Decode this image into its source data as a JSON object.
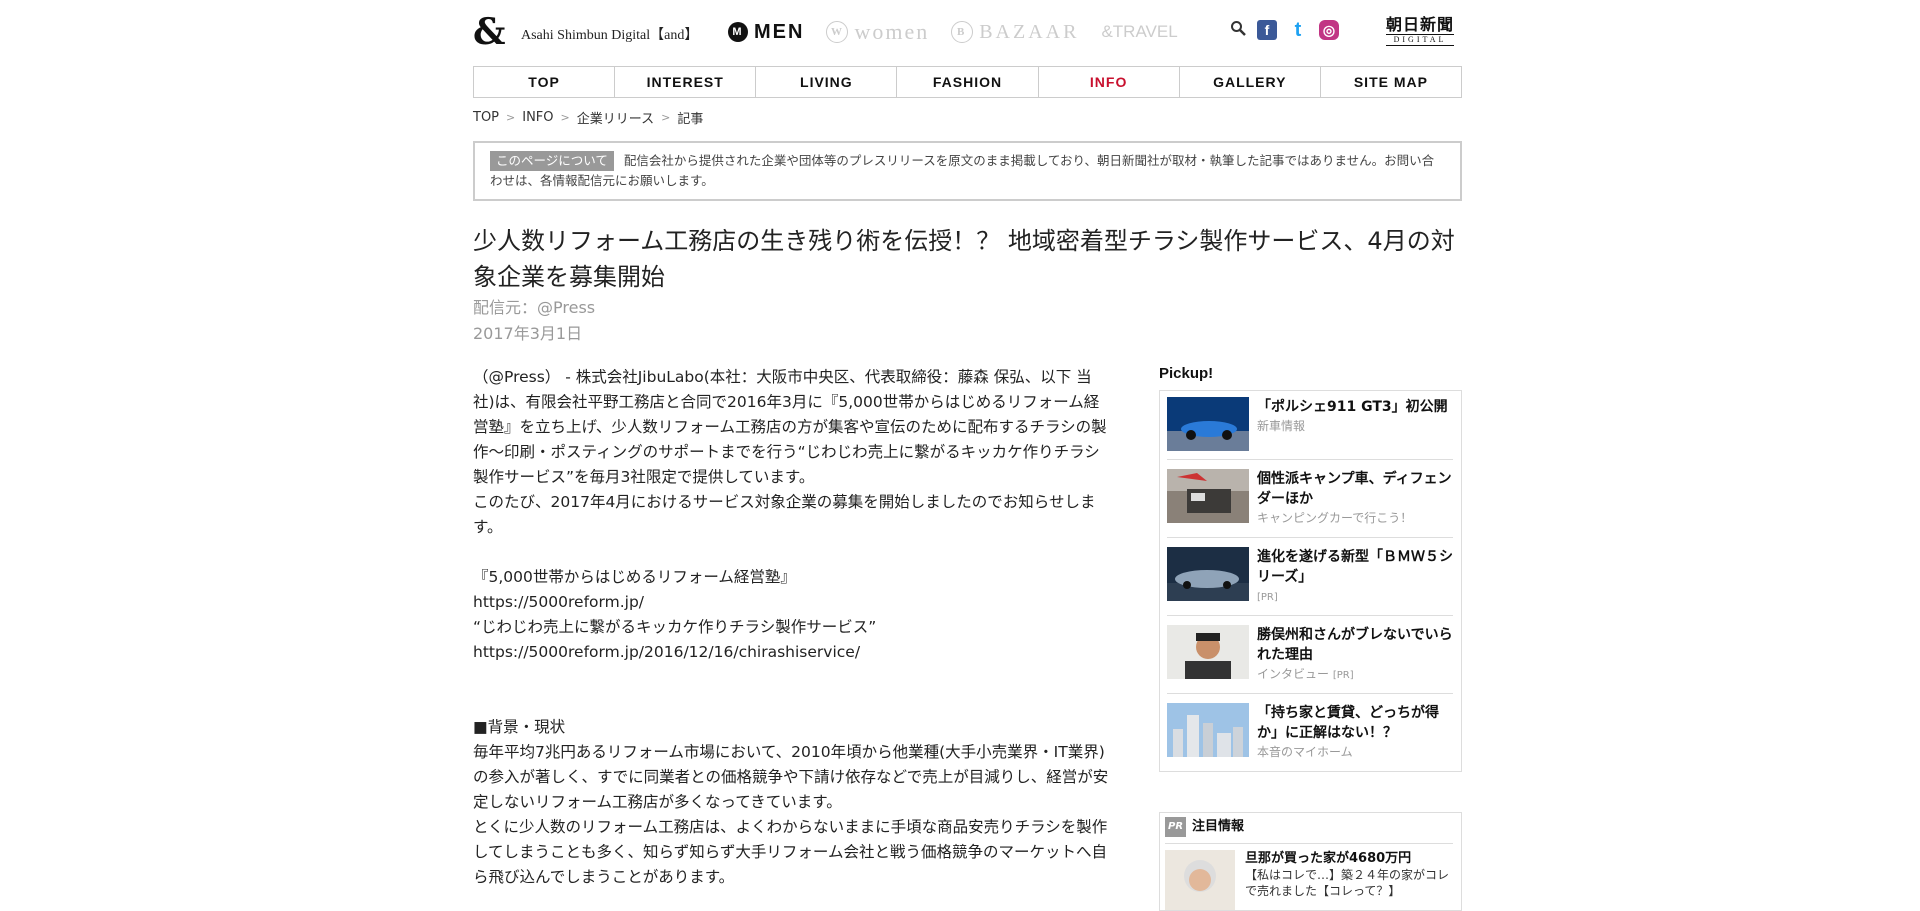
{
  "header": {
    "logo": "&",
    "site_name": "Asahi Shimbun Digital【and】",
    "brands": [
      {
        "icon": "M",
        "label": "MEN"
      },
      {
        "icon": "W",
        "label": "women"
      },
      {
        "icon": "B",
        "label": "BAZAAR"
      },
      {
        "label": "&TRAVEL"
      }
    ],
    "social": [
      "f",
      "t",
      "◎"
    ],
    "asahi_jp": "朝日新聞",
    "asahi_digital": "DIGITAL"
  },
  "nav": [
    "TOP",
    "INTEREST",
    "LIVING",
    "FASHION",
    "INFO",
    "GALLERY",
    "SITE MAP"
  ],
  "breadcrumb": [
    "TOP",
    "INFO",
    "企業リリース",
    "記事"
  ],
  "notice": {
    "tag": "このページについて",
    "text": "配信会社から提供された企業や団体等のプレスリリースを原文のまま掲載しており、朝日新聞社が取材・執筆した記事ではありません。お問い合わせは、各情報配信元にお願いします。"
  },
  "article": {
    "title": "少人数リフォーム工務店の生き残り術を伝授！？ 地域密着型チラシ製作サービス、4月の対象企業を募集開始",
    "source": "配信元：@Press",
    "date": "2017年3月1日",
    "paragraphs": [
      "（@Press） - 株式会社JibuLabo(本社：大阪市中央区、代表取締役：藤森 保弘、以下 当社)は、有限会社平野工務店と合同で2016年3月に『5,000世帯からはじめるリフォーム経営塾』を立ち上げ、少人数リフォーム工務店の方が集客や宣伝のために配布するチラシの製作～印刷・ポスティングのサポートまでを行う“じわじわ売上に繋がるキッカケ作りチラシ製作サービス”を毎月3社限定で提供しています。\nこのたび、2017年4月におけるサービス対象企業の募集を開始しましたのでお知らせします。",
      "『5,000世帯からはじめるリフォーム経営塾』\nhttps://5000reform.jp/\n“じわじわ売上に繋がるキッカケ作りチラシ製作サービス”\nhttps://5000reform.jp/2016/12/16/chirashiservice/",
      "■背景・現状\n毎年平均7兆円あるリフォーム市場において、2010年頃から他業種(大手小売業界・IT業界)の参入が著しく、すでに同業者との価格競争や下請け依存などで売上が目減りし、経営が安定しないリフォーム工務店が多くなってきています。\nとくに少人数のリフォーム工務店は、よくわからないままに手頃な商品安売りチラシを製作してしまうことも多く、知らず知らず大手リフォーム会社と戦う価格競争のマーケットへ自ら飛び込んでしまうことがあります。"
    ]
  },
  "pickup": {
    "heading": "Pickup!",
    "items": [
      {
        "title": "「ポルシェ911 GT3」初公開",
        "sub": "新車情報",
        "pr": ""
      },
      {
        "title": "個性派キャンプ車、ディフェンダーほか",
        "sub": "キャンピングカーで行こう！",
        "pr": ""
      },
      {
        "title": "進化を遂げる新型「ＢＭＷ５シリーズ」",
        "sub": "",
        "pr": "[PR]"
      },
      {
        "title": "勝俣州和さんがブレないでいられた理由",
        "sub": "インタビュー",
        "pr": "[PR]"
      },
      {
        "title": "「持ち家と賃貸、どっちが得か」に正解はない！？",
        "sub": "本音のマイホーム",
        "pr": ""
      }
    ]
  },
  "notable": {
    "badge": "PR",
    "heading": "注目情報",
    "item": {
      "title": "旦那が買った家が4680万円",
      "sub": "【私はコレで…】築２４年の家がコレで売れました【コレって？】"
    }
  }
}
